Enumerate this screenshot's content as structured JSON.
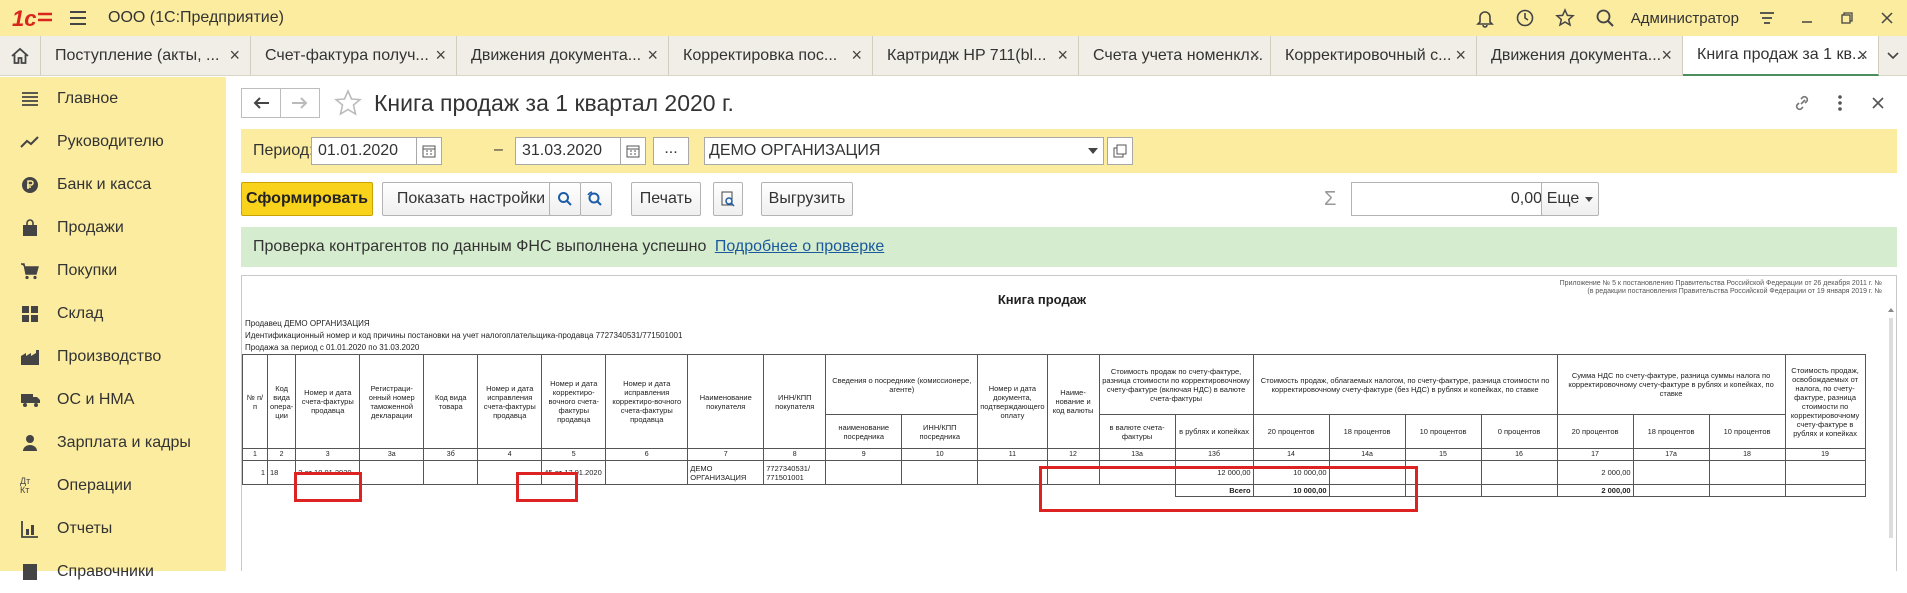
{
  "app": {
    "title": "ООО  (1С:Предприятие)",
    "user": "Администратор"
  },
  "tabs": [
    {
      "label": "Поступление (акты, ..."
    },
    {
      "label": "Счет-фактура получ..."
    },
    {
      "label": "Движения документа..."
    },
    {
      "label": "Корректировка пос..."
    },
    {
      "label": "Картридж HP 711(bl..."
    },
    {
      "label": "Счета учета номенкл..."
    },
    {
      "label": "Корректировочный с..."
    },
    {
      "label": "Движения документа..."
    },
    {
      "label": "Книга продаж за 1 кв..."
    }
  ],
  "sidebar": {
    "items": [
      {
        "label": "Главное",
        "icon": "menu-lines-icon"
      },
      {
        "label": "Руководителю",
        "icon": "trend-chart-icon"
      },
      {
        "label": "Банк и касса",
        "icon": "ruble-coin-icon"
      },
      {
        "label": "Продажи",
        "icon": "shopping-bag-icon"
      },
      {
        "label": "Покупки",
        "icon": "cart-icon"
      },
      {
        "label": "Склад",
        "icon": "warehouse-grid-icon"
      },
      {
        "label": "Производство",
        "icon": "factory-icon"
      },
      {
        "label": "ОС и НМА",
        "icon": "truck-icon"
      },
      {
        "label": "Зарплата и кадры",
        "icon": "person-icon"
      },
      {
        "label": "Операции",
        "icon": "dt-kt-icon",
        "icon_text": "Дт Кт"
      },
      {
        "label": "Отчеты",
        "icon": "bar-chart-icon"
      },
      {
        "label": "Справочники",
        "icon": "book-icon"
      }
    ]
  },
  "page": {
    "title": "Книга продаж за 1 квартал 2020 г."
  },
  "period": {
    "label": "Период:",
    "from": "01.01.2020",
    "dash": "–",
    "to": "31.03.2020",
    "dots": "...",
    "organization": "ДЕМО ОРГАНИЗАЦИЯ"
  },
  "toolbar": {
    "generate": "Сформировать",
    "show_settings": "Показать настройки",
    "print": "Печать",
    "export": "Выгрузить",
    "sigma": "Σ",
    "sum": "0,00",
    "more": "Еще"
  },
  "notice": {
    "text": "Проверка контрагентов по данным ФНС выполнена успешно",
    "link": "Подробнее о проверке"
  },
  "report": {
    "appendix_line1": "Приложение № 5 к постановлению Правительства Российской Федерации от 26 декабря 2011 г. №",
    "appendix_line2": "(в редакции постановления Правительства Российской Федерации от 19 января 2019 г. №",
    "title": "Книга продаж",
    "seller": "Продавец  ДЕМО ОРГАНИЗАЦИЯ",
    "inn_line": "Идентификационный номер и код причины постановки на учет налогоплательщика-продавца  7727340531/771501001",
    "period_line": "Продажа за период с 01.01.2020 по 31.03.2020",
    "headers": {
      "h1": "№ п/п",
      "h2": "Код вида опера-ции",
      "h3": "Номер и дата счета-фактуры продавца",
      "h3a": "Регистраци-онный номер таможенной декларации",
      "h3b": "Код вида товара",
      "h4": "Номер и дата исправления счета-фактуры продавца",
      "h5": "Номер и дата корректиро-вочного счета-фактуры продавца",
      "h6": "Номер и дата исправления корректиро-вочного счета-фактуры продавца",
      "h7": "Наименование покупателя",
      "h8": "ИНН/КПП покупателя",
      "h9_10": "Сведения о посреднике (комиссионере, агенте)",
      "h9": "наименование посредника",
      "h10": "ИНН/КПП посредника",
      "h11": "Номер и дата документа, подтверждающего оплату",
      "h12": "Наиме-нование и код валюты",
      "h13": "Стоимость продаж по счету-фактуре, разница стоимости по корректировочному счету-фактуре (включая НДС) в валюте счета-фактуры",
      "h13a": "в валюте счета-фактуры",
      "h13b": "в рублях и копейках",
      "h14_16": "Стоимость продаж, облагаемых налогом, по счету-фактуре, разница стоимости по корректировочному счету-фактуре (без НДС) в рублях и копейках, по ставке",
      "h14": "20 процентов",
      "h14a": "18 процентов",
      "h15": "10 процентов",
      "h16": "0 процентов",
      "h17_18": "Сумма НДС по счету-фактуре, разница суммы налога по корректировочному счету-фактуре в рублях и копейках, по ставке",
      "h17": "20 процентов",
      "h17a": "18 процентов",
      "h18": "10 процентов",
      "h19": "Стоимость продаж, освобождаемых от налога, по счету-фактуре, разница стоимости по корректировочному счету-фактуре в рублях и копейках"
    },
    "col_numbers": [
      "1",
      "2",
      "3",
      "3а",
      "3б",
      "4",
      "5",
      "6",
      "7",
      "8",
      "9",
      "10",
      "11",
      "12",
      "13а",
      "13б",
      "14",
      "14а",
      "15",
      "16",
      "17",
      "17а",
      "18",
      "19"
    ],
    "row": {
      "num": "1",
      "op_code": "18",
      "invoice": "2 от 10.01.2020",
      "corr_invoice": "45 от 17.01.2020",
      "buyer": "ДЕМО ОРГАНИЗАЦИЯ",
      "buyer_inn": "7727340531/ 771501001",
      "total_rub": "12 000,00",
      "base_20": "10 000,00",
      "vat_20": "2 000,00"
    },
    "totals": {
      "label": "Всего",
      "base_20": "10 000,00",
      "vat_20": "2 000,00"
    }
  }
}
